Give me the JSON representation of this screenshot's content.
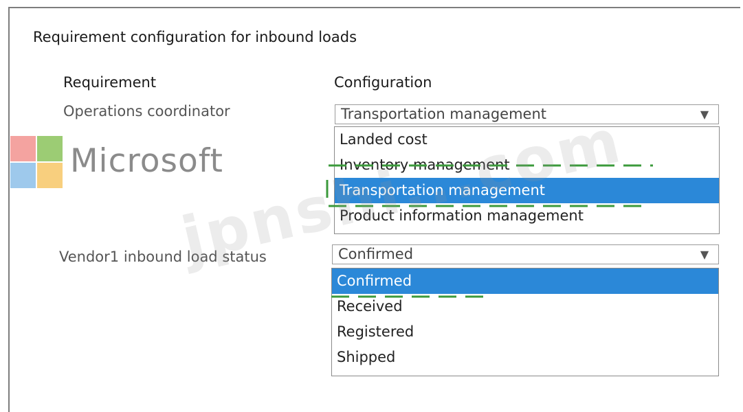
{
  "title": "Requirement configuration for inbound loads",
  "headers": {
    "requirement": "Requirement",
    "configuration": "Configuration"
  },
  "rows": [
    {
      "label": "Operations coordinator",
      "selected_value": "Transportation management",
      "options": [
        "Landed cost",
        "Inventory management",
        "Transportation management",
        "Product information management"
      ],
      "highlighted_option": "Transportation management"
    },
    {
      "label": "Vendor1 inbound load status",
      "selected_value": "Confirmed",
      "options": [
        "Confirmed",
        "Received",
        "Registered",
        "Shipped"
      ],
      "highlighted_option": "Confirmed"
    }
  ],
  "icons": {
    "dropdown": "chevron-down-icon"
  },
  "watermark": {
    "brand": "Microsoft",
    "site": "jpnshi...com"
  },
  "colors": {
    "selection": "#2b88d8",
    "dashed_outline": "#3b9a3b",
    "ms_red": "#f25022",
    "ms_green": "#7fba00",
    "ms_blue": "#00a4ef",
    "ms_yellow": "#ffb900"
  }
}
